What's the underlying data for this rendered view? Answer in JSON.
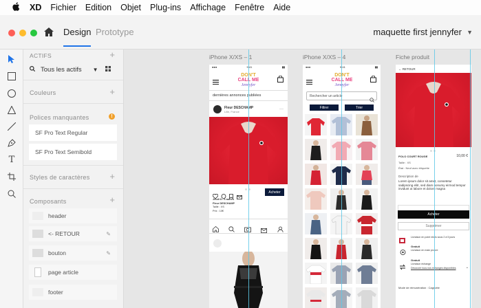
{
  "menubar": {
    "app": "XD",
    "items": [
      "Fichier",
      "Edition",
      "Objet",
      "Plug-ins",
      "Affichage",
      "Fenêtre",
      "Aide"
    ]
  },
  "toolbar": {
    "tab_design": "Design",
    "tab_prototype": "Prototype",
    "document_title": "maquette first jennyfer"
  },
  "colors": {
    "accent": "#1f74e8",
    "guide": "#5ec8e6",
    "navy": "#0b1a3a",
    "warning": "#f1a02b"
  },
  "tools": [
    "select-arrow-icon",
    "rectangle-icon",
    "ellipse-icon",
    "triangle-icon",
    "line-icon",
    "pen-icon",
    "text-icon",
    "artboard-icon",
    "zoom-icon"
  ],
  "assets": {
    "header": "ACTIFS",
    "filter": "Tous les actifs",
    "colors_label": "Couleurs",
    "missing_fonts_label": "Polices manquantes",
    "missing_fonts": [
      "SF Pro Text Regular",
      "SF Pro Text Semibold"
    ],
    "char_styles_label": "Styles de caractères",
    "components_label": "Composants",
    "components": [
      "header",
      "<- RETOUR",
      "bouton",
      "page article",
      "footer"
    ]
  },
  "artboards": {
    "a1": {
      "title": "iPhone X/XS – 1",
      "search_text": "dernières annonces publiées",
      "user_name": "Fleur DESCHAMP",
      "user_city": "Lille, France",
      "post_date": "Jeudi 8 • 6 autres",
      "post_brand": "Fleur DESCHAMP",
      "post_size": "Taille : XS",
      "post_price": "Prix : 10€",
      "buy_label": "Acheter"
    },
    "a2": {
      "title": "iPhone X/XS – 4",
      "search_placeholder": "Rechercher un article",
      "filter_label": "Filtrer",
      "sort_label": "Trier"
    },
    "a3": {
      "title": "Fiche produit",
      "back_label": "RETOUR",
      "product_name": "POLO COURT ROUGE",
      "product_price": "10,00 €",
      "size": "Taille : XS",
      "state": "État : Neuf avec étiquette",
      "description_title": "Description de",
      "description": "Lorem ipsum dolor sit amet, consetetur sadipscing elitr, sed diam nonumy eirmod tempor invidunt ut labore et dolore magna",
      "buy_label": "Acheter",
      "delete_label": "Supprimer",
      "ship1": "Livraison en point relais sous 2 à 5 jours",
      "ship2_title": "Gratuit",
      "ship2": "Livraison en main propre",
      "ship3_title": "Gratuit",
      "ship3": "Livraison échange",
      "ship3_link": "Découvrir tous nos échanges disponibles",
      "payment": "Mode de rémunération : Cagnotte"
    }
  }
}
